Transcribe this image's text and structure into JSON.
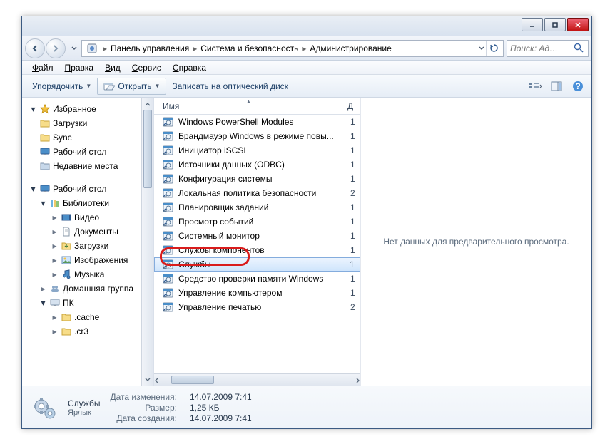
{
  "breadcrumbs": [
    "Панель управления",
    "Система и безопасность",
    "Администрирование"
  ],
  "search_placeholder": "Поиск: Ад…",
  "menu": {
    "file": "Файл",
    "edit": "Правка",
    "view": "Вид",
    "tools": "Сервис",
    "help": "Справка"
  },
  "toolbar": {
    "organize": "Упорядочить",
    "open": "Открыть",
    "burn": "Записать на оптический диск"
  },
  "nav": {
    "favorites": {
      "label": "Избранное",
      "items": [
        "Загрузки",
        "Sync",
        "Рабочий стол",
        "Недавние места"
      ]
    },
    "desktop": {
      "label": "Рабочий стол",
      "libraries": {
        "label": "Библиотеки",
        "items": [
          "Видео",
          "Документы",
          "Загрузки",
          "Изображения",
          "Музыка"
        ]
      },
      "homegroup": "Домашняя группа",
      "pc": {
        "label": "ПК",
        "items": [
          ".cache",
          ".cr3"
        ]
      }
    }
  },
  "list": {
    "name_header": "Имя",
    "date_header": "Д",
    "items": [
      {
        "name": "Windows PowerShell Modules",
        "d": "1"
      },
      {
        "name": "Брандмауэр Windows в режиме повы...",
        "d": "1"
      },
      {
        "name": "Инициатор iSCSI",
        "d": "1"
      },
      {
        "name": "Источники данных (ODBC)",
        "d": "1"
      },
      {
        "name": "Конфигурация системы",
        "d": "1"
      },
      {
        "name": "Локальная политика безопасности",
        "d": "2"
      },
      {
        "name": "Планировщик заданий",
        "d": "1"
      },
      {
        "name": "Просмотр событий",
        "d": "1"
      },
      {
        "name": "Системный монитор",
        "d": "1"
      },
      {
        "name": "Службы компонентов",
        "d": "1"
      },
      {
        "name": "Службы",
        "d": "1",
        "selected": true
      },
      {
        "name": "Средство проверки памяти Windows",
        "d": "1"
      },
      {
        "name": "Управление компьютером",
        "d": "1"
      },
      {
        "name": "Управление печатью",
        "d": "2"
      }
    ]
  },
  "preview_empty": "Нет данных для предварительного просмотра.",
  "details": {
    "name": "Службы",
    "type": "Ярлык",
    "modified_label": "Дата изменения:",
    "modified": "14.07.2009 7:41",
    "size_label": "Размер:",
    "size": "1,25 КБ",
    "created_label": "Дата создания:",
    "created": "14.07.2009 7:41"
  }
}
